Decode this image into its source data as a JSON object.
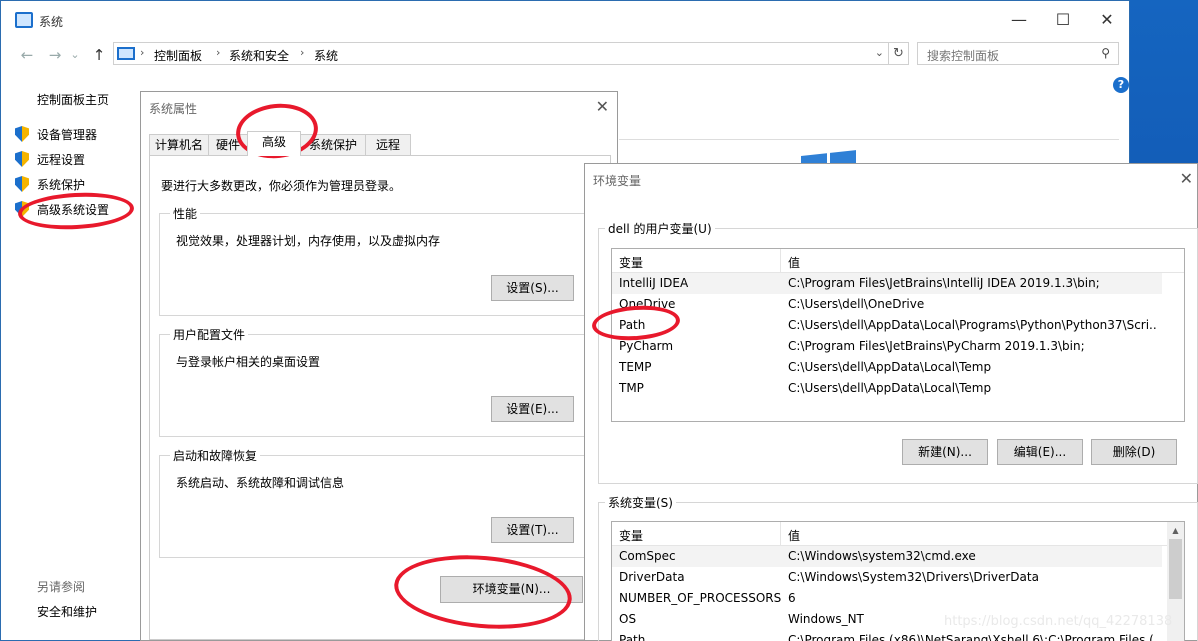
{
  "window": {
    "title": "系统",
    "minimize": "—",
    "maximize": "☐",
    "close": "✕"
  },
  "nav": {
    "back": "←",
    "forward": "→",
    "dropdown": "⌄",
    "up": "↑"
  },
  "breadcrumb": {
    "items": [
      "控制面板",
      "系统和安全",
      "系统"
    ],
    "sep": "›",
    "dropdown": "⌄",
    "refresh": "↻"
  },
  "search": {
    "placeholder": "搜索控制面板",
    "icon": "⚲"
  },
  "help": "?",
  "sidebar": {
    "home": "控制面板主页",
    "items": [
      {
        "label": "设备管理器",
        "icon": "shield-icon"
      },
      {
        "label": "远程设置",
        "icon": "shield-icon"
      },
      {
        "label": "系统保护",
        "icon": "shield-icon"
      },
      {
        "label": "高级系统设置",
        "icon": "shield-icon"
      }
    ],
    "see_also": "另请参阅",
    "security_maintenance": "安全和维护"
  },
  "system_properties": {
    "title": "系统属性",
    "close": "✕",
    "tabs": [
      "计算机名",
      "硬件",
      "高级",
      "系统保护",
      "远程"
    ],
    "active_tab": "高级",
    "admin_note": "要进行大多数更改，你必须作为管理员登录。",
    "groups": [
      {
        "title": "性能",
        "desc": "视觉效果，处理器计划，内存使用，以及虚拟内存",
        "button": "设置(S)..."
      },
      {
        "title": "用户配置文件",
        "desc": "与登录帐户相关的桌面设置",
        "button": "设置(E)..."
      },
      {
        "title": "启动和故障恢复",
        "desc": "系统启动、系统故障和调试信息",
        "button": "设置(T)..."
      }
    ],
    "env_button": "环境变量(N)..."
  },
  "env_vars": {
    "title": "环境变量",
    "close": "✕",
    "user_group_title": "dell 的用户变量(U)",
    "col_var": "变量",
    "col_val": "值",
    "user_vars": [
      {
        "name": "IntelliJ IDEA",
        "value": "C:\\Program Files\\JetBrains\\IntelliJ IDEA 2019.1.3\\bin;"
      },
      {
        "name": "OneDrive",
        "value": "C:\\Users\\dell\\OneDrive"
      },
      {
        "name": "Path",
        "value": "C:\\Users\\dell\\AppData\\Local\\Programs\\Python\\Python37\\Scri..."
      },
      {
        "name": "PyCharm",
        "value": "C:\\Program Files\\JetBrains\\PyCharm 2019.1.3\\bin;"
      },
      {
        "name": "TEMP",
        "value": "C:\\Users\\dell\\AppData\\Local\\Temp"
      },
      {
        "name": "TMP",
        "value": "C:\\Users\\dell\\AppData\\Local\\Temp"
      }
    ],
    "user_buttons": [
      "新建(N)...",
      "编辑(E)...",
      "删除(D)"
    ],
    "system_group_title": "系统变量(S)",
    "system_vars": [
      {
        "name": "ComSpec",
        "value": "C:\\Windows\\system32\\cmd.exe"
      },
      {
        "name": "DriverData",
        "value": "C:\\Windows\\System32\\Drivers\\DriverData"
      },
      {
        "name": "NUMBER_OF_PROCESSORS",
        "value": "6"
      },
      {
        "name": "OS",
        "value": "Windows_NT"
      },
      {
        "name": "Path",
        "value": "C:\\Program Files (x86)\\NetSarang\\Xshell 6\\;C:\\Program Files (..."
      }
    ],
    "scroll_up": "▲",
    "scroll_down": "▼"
  },
  "watermark": "https://blog.csdn.net/qq_42278138",
  "colors": {
    "accent": "#1b6fcc",
    "annotation": "#e8192c"
  }
}
